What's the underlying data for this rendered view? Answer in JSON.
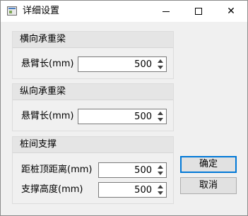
{
  "window": {
    "title": "详细设置",
    "minimize_label": "—",
    "maximize_label": "□",
    "close_label": "✕"
  },
  "groups": [
    {
      "header": "横向承重梁",
      "fields": [
        {
          "label": "悬臂长(mm)",
          "value": "500"
        }
      ]
    },
    {
      "header": "纵向承重梁",
      "fields": [
        {
          "label": "悬臂长(mm)",
          "value": "500"
        }
      ]
    },
    {
      "header": "桩间支撑",
      "fields": [
        {
          "label": "距桩顶距离(mm)",
          "value": "500"
        },
        {
          "label": "支撑高度(mm)",
          "value": "500"
        }
      ]
    }
  ],
  "buttons": {
    "ok": "确定",
    "cancel": "取消"
  },
  "icons": {
    "app": "window-app-icon",
    "spin_up": "arrow-up-icon",
    "spin_down": "arrow-down-icon"
  }
}
